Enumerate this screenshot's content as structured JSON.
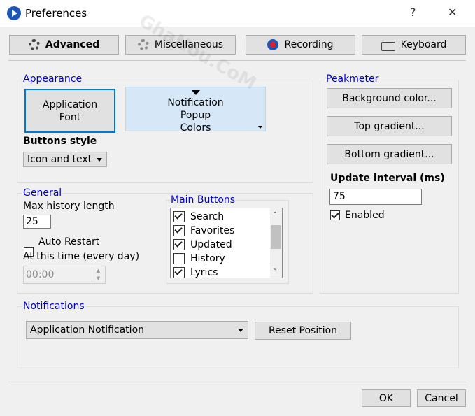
{
  "window": {
    "title": "Preferences",
    "help": "?",
    "close": "✕"
  },
  "tabs": [
    {
      "label": "Advanced",
      "icon": "gear-icon"
    },
    {
      "label": "Miscellaneous",
      "icon": "gear-icon"
    },
    {
      "label": "Recording",
      "icon": "record-icon"
    },
    {
      "label": "Keyboard",
      "icon": "keyboard-icon"
    }
  ],
  "appearance": {
    "title": "Appearance",
    "app_font_line1": "Application",
    "app_font_line2": "Font",
    "notif_line1": "Notification",
    "notif_line2": "Popup",
    "notif_line3": "Colors",
    "buttons_style_label": "Buttons style",
    "buttons_style_value": "Icon and text"
  },
  "peakmeter": {
    "title": "Peakmeter",
    "background_color": "Background color...",
    "top_gradient": "Top gradient...",
    "bottom_gradient": "Bottom gradient...",
    "update_interval_label": "Update interval (ms)",
    "update_interval_value": "75",
    "enabled_label": "Enabled",
    "enabled_checked": true
  },
  "general": {
    "title": "General",
    "max_history_label": "Max history length",
    "max_history_value": "25",
    "auto_restart_label": "Auto Restart",
    "auto_restart_checked": false,
    "at_time_label": "At this time (every day)",
    "time_value": "00:00"
  },
  "main_buttons": {
    "title": "Main Buttons",
    "items": [
      {
        "label": "Search",
        "checked": true
      },
      {
        "label": "Favorites",
        "checked": true
      },
      {
        "label": "Updated",
        "checked": true
      },
      {
        "label": "History",
        "checked": false
      },
      {
        "label": "Lyrics",
        "checked": true
      }
    ]
  },
  "notifications": {
    "title": "Notifications",
    "selected": "Application Notification",
    "reset_position": "Reset Position"
  },
  "footer": {
    "ok": "OK",
    "cancel": "Cancel"
  },
  "watermark": "GhaNou.CoM"
}
